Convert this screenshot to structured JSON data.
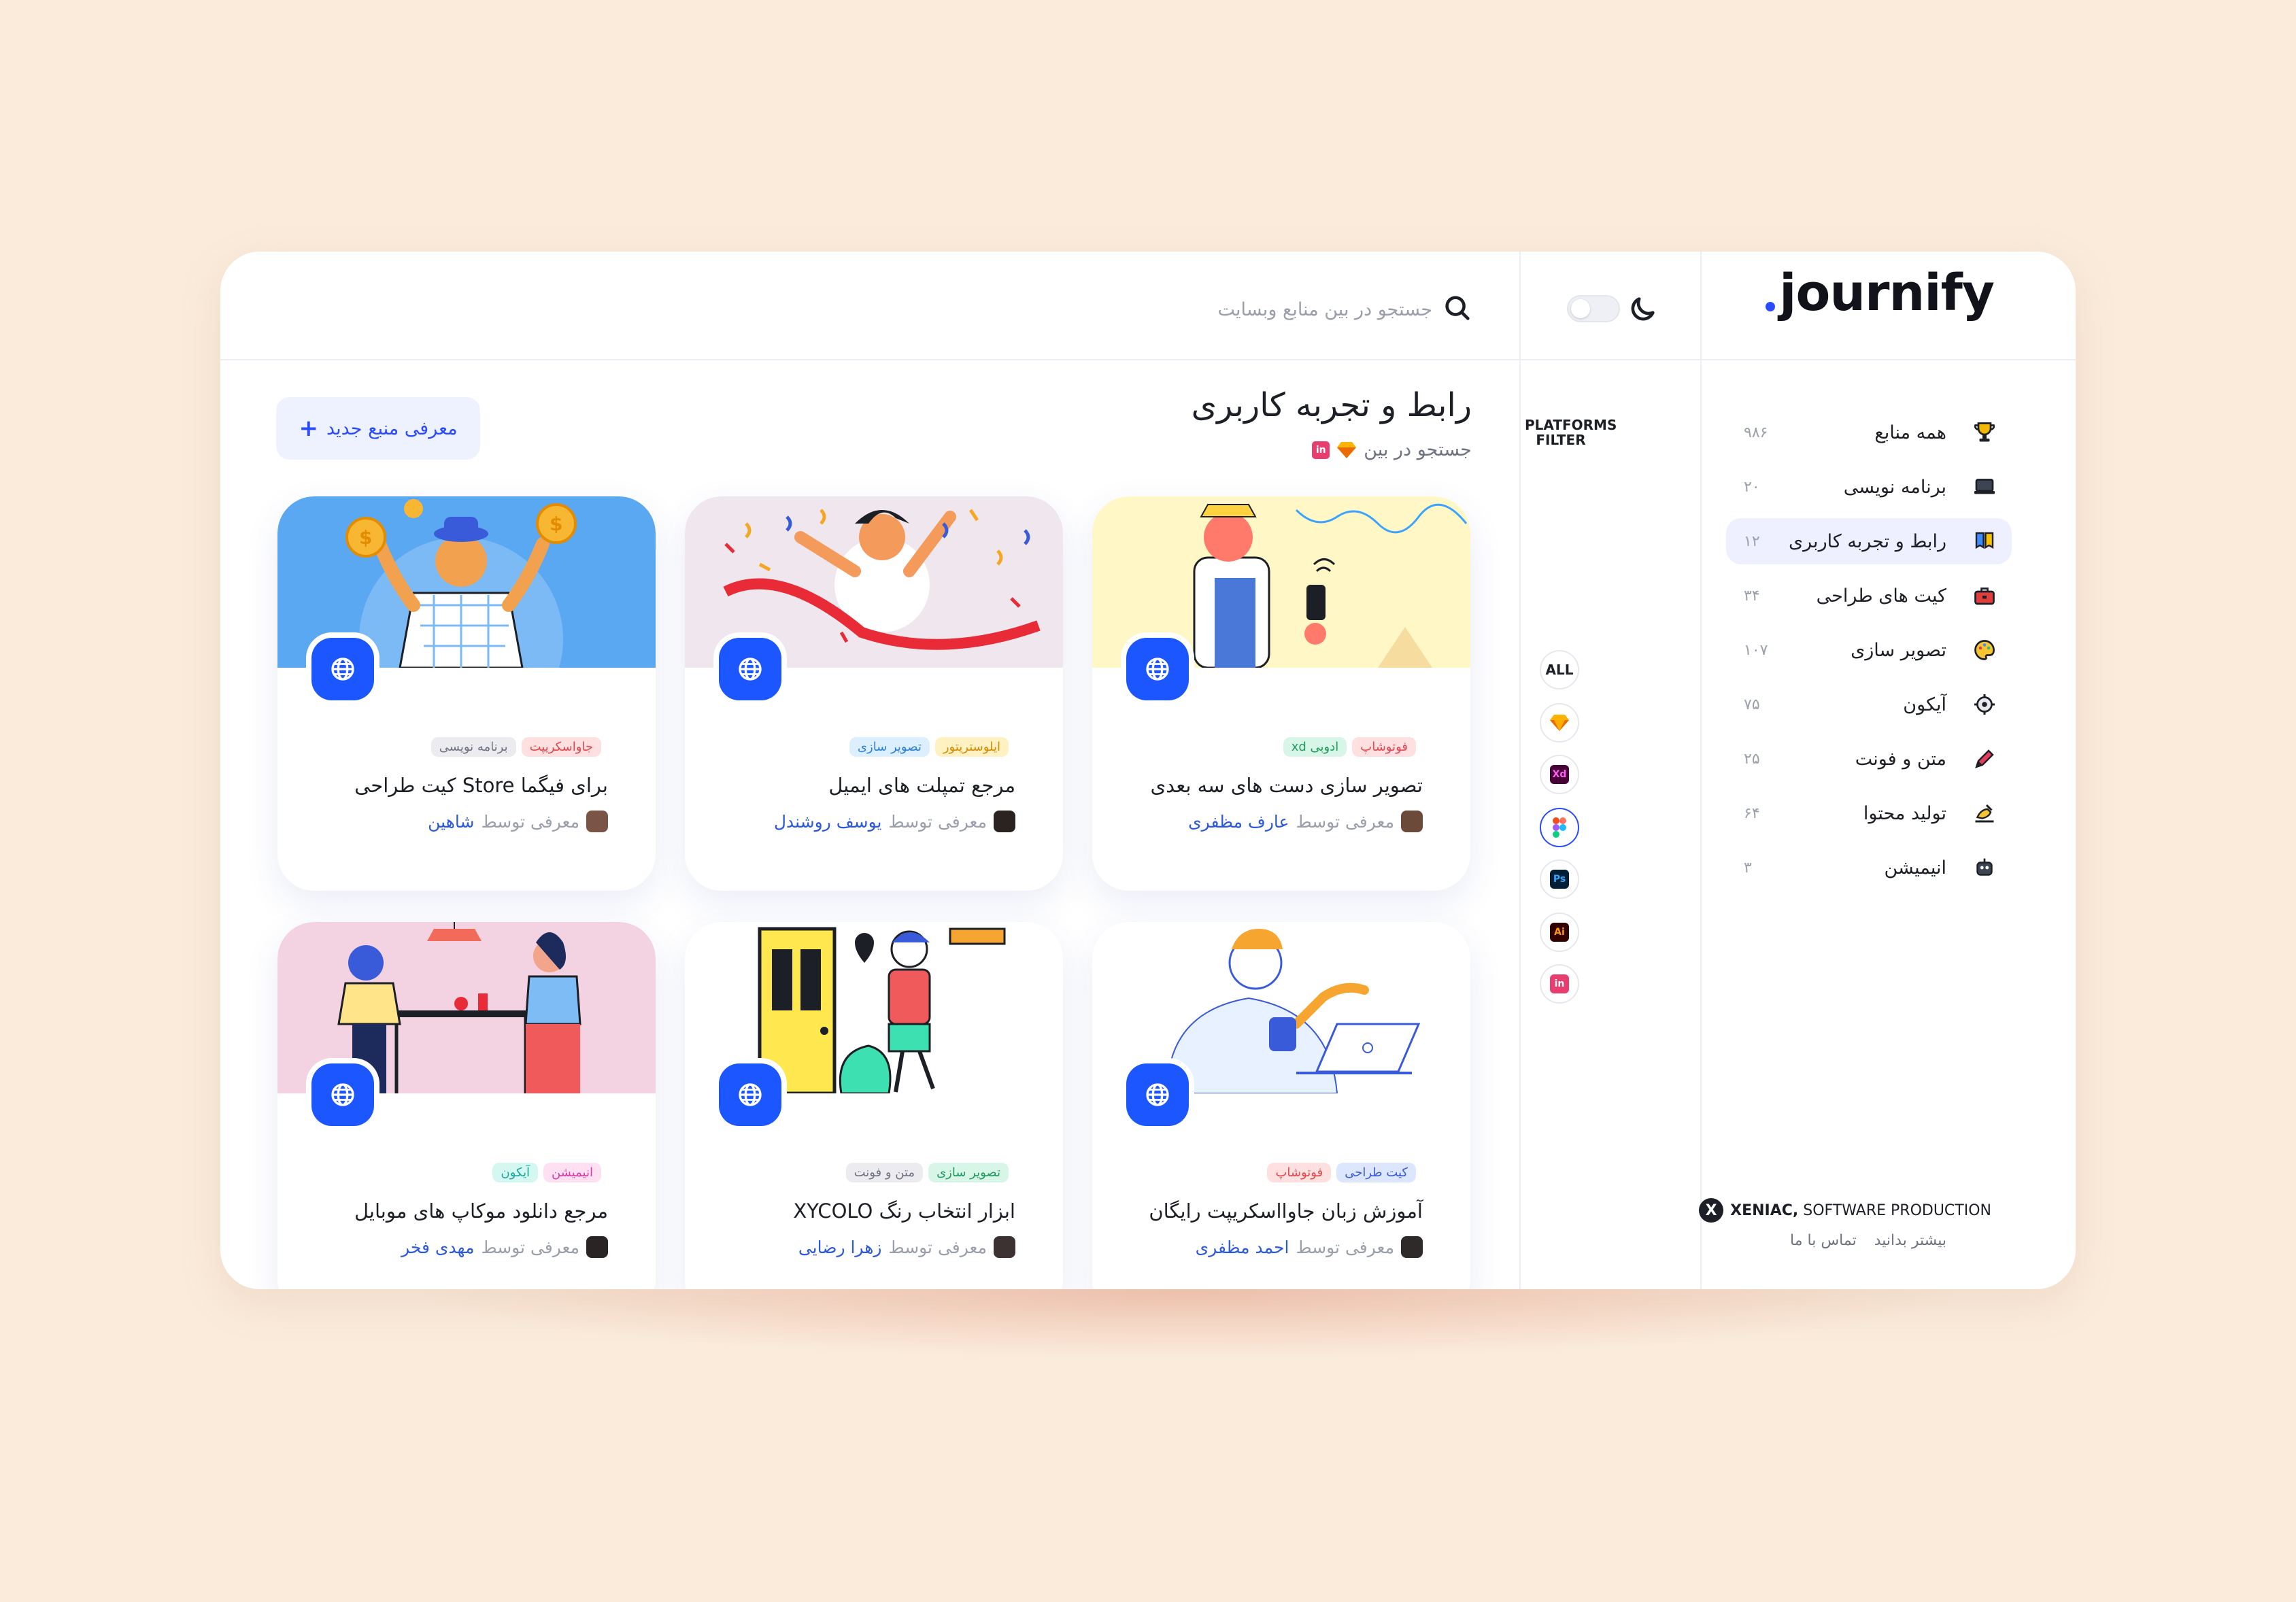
{
  "app": {
    "logo": "journify"
  },
  "search": {
    "placeholder": "جستجو در بین منابع وبسایت"
  },
  "sidebar": {
    "items": [
      {
        "label": "همه منابع",
        "count": "۹۸۶",
        "icon": "trophy-icon"
      },
      {
        "label": "برنامه نویسی",
        "count": "۲۰",
        "icon": "laptop-icon"
      },
      {
        "label": "رابط و تجربه کاربری",
        "count": "۱۲",
        "icon": "ux-icon",
        "active": true
      },
      {
        "label": "کیت های طراحی",
        "count": "۳۴",
        "icon": "toolbox-icon"
      },
      {
        "label": "تصویر سازی",
        "count": "۱۰۷",
        "icon": "palette-icon"
      },
      {
        "label": "آیکون",
        "count": "۷۵",
        "icon": "gear-icon"
      },
      {
        "label": "متن و فونت",
        "count": "۲۵",
        "icon": "pencil-icon"
      },
      {
        "label": "تولید محتوا",
        "count": "۶۴",
        "icon": "writing-hand-icon"
      },
      {
        "label": "انیمیشن",
        "count": "۳",
        "icon": "robot-icon"
      }
    ],
    "brand_bold": "XENIAC,",
    "brand_rest": "SOFTWARE PRODUCTION",
    "footer_more": "بیشتر بدانید",
    "footer_contact": "تماس با ما"
  },
  "platforms": {
    "title_line1": "PLATFORMS",
    "title_line2": "FILTER",
    "all_label": "ALL",
    "xd_label": "Xd",
    "ps_label": "Ps",
    "ai_label": "Ai",
    "in_label": "in"
  },
  "main": {
    "title": "رابط و تجربه کاربری",
    "filter_prefix": "جستجو در بین",
    "add_button": "معرفی منبع جدید",
    "by_prefix": "معرفی توسط"
  },
  "cards": [
    {
      "title": "تصویر سازی دست های سه بعدی",
      "author": "عارف مظفری",
      "tags": [
        "فوتوشاپ",
        "ادوبی xd"
      ]
    },
    {
      "title": "مرجع تمپلت های ایمیل",
      "author": "یوسف روشندل",
      "tags": [
        "ایلوستریتور",
        "تصویر سازی"
      ]
    },
    {
      "title": "برای فیگما Store کیت طراحی",
      "author": "شاهین",
      "tags": [
        "جاواسکریپت",
        "برنامه نویسی"
      ]
    },
    {
      "title": "آموزش زبان جاوااسکریپت رایگان",
      "author": "احمد مظفری",
      "tags": [
        "کیت طراحی",
        "فوتوشاپ"
      ]
    },
    {
      "title": "ابزار انتخاب رنگ XYCOLO",
      "author": "زهرا رضایی",
      "tags": [
        "تصویر سازی",
        "متن و فونت"
      ]
    },
    {
      "title": "مرجع دانلود موکاپ های موبایل",
      "author": "مهدی فخر",
      "tags": [
        "انیمیشن",
        "آیکون"
      ]
    }
  ],
  "colors": {
    "accent": "#1b56ff",
    "background": "#faebdb"
  }
}
